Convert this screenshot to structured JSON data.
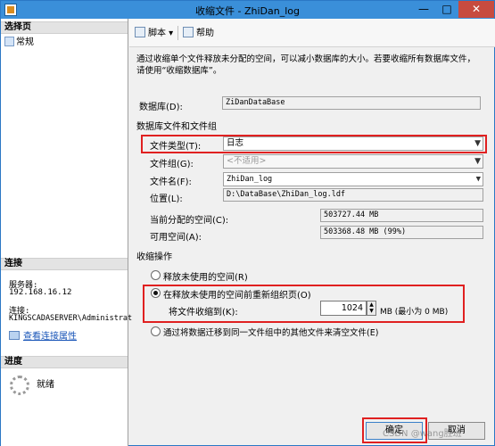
{
  "window": {
    "title": "收缩文件 - ZhiDan_log",
    "min_label": "—",
    "max_label": "□",
    "close_label": "✕"
  },
  "left_panel": {
    "select_page_header": "选择页",
    "pages": [
      "常规"
    ],
    "connection_header": "连接",
    "server_label": "服务器:",
    "server_value": "192.168.16.12",
    "connection_label": "连接:",
    "connection_value": "KINGSCADASERVER\\Administrat",
    "view_connection_props": "查看连接属性",
    "progress_header": "进度",
    "progress_status": "就绪"
  },
  "toolbar": {
    "script_label": "脚本 ▾",
    "help_label": "帮助"
  },
  "info_text": "通过收缩单个文件释放未分配的空间，可以减小数据库的大小。若要收缩所有数据库文件，请使用“收缩数据库”。",
  "form": {
    "database_label": "数据库(D):",
    "database_value": "ZiDanDataBase",
    "group_header": "数据库文件和文件组",
    "file_type_label": "文件类型(T):",
    "file_type_value": "日志",
    "filegroup_label": "文件组(G):",
    "filegroup_value": "<不适用>",
    "filename_label": "文件名(F):",
    "filename_value": "ZhiDan_log",
    "location_label": "位置(L):",
    "location_value": "D:\\DataBase\\ZhiDan_log.ldf",
    "allocated_label": "当前分配的空间(C):",
    "allocated_value": "503727.44 MB",
    "available_label": "可用空间(A):",
    "available_value": "503368.48 MB (99%)"
  },
  "shrink": {
    "header": "收缩操作",
    "option_release": "释放未使用的空间(R)",
    "option_reorganize": "在释放未使用的空间前重新组织页(O)",
    "shrink_to_label": "将文件收缩到(K):",
    "shrink_to_value": "1024",
    "shrink_to_unit": "MB (最小为 0 MB)",
    "option_empty": "通过将数据迁移到同一文件组中的其他文件来清空文件(E)",
    "selected_option": "reorganize"
  },
  "buttons": {
    "ok_label": "确定",
    "cancel_label": "取消"
  },
  "watermark": "CSDN @wang胜班",
  "colors": {
    "highlight": "#e02020",
    "title_bar": "#3a8fd9",
    "link": "#1a56b8"
  }
}
